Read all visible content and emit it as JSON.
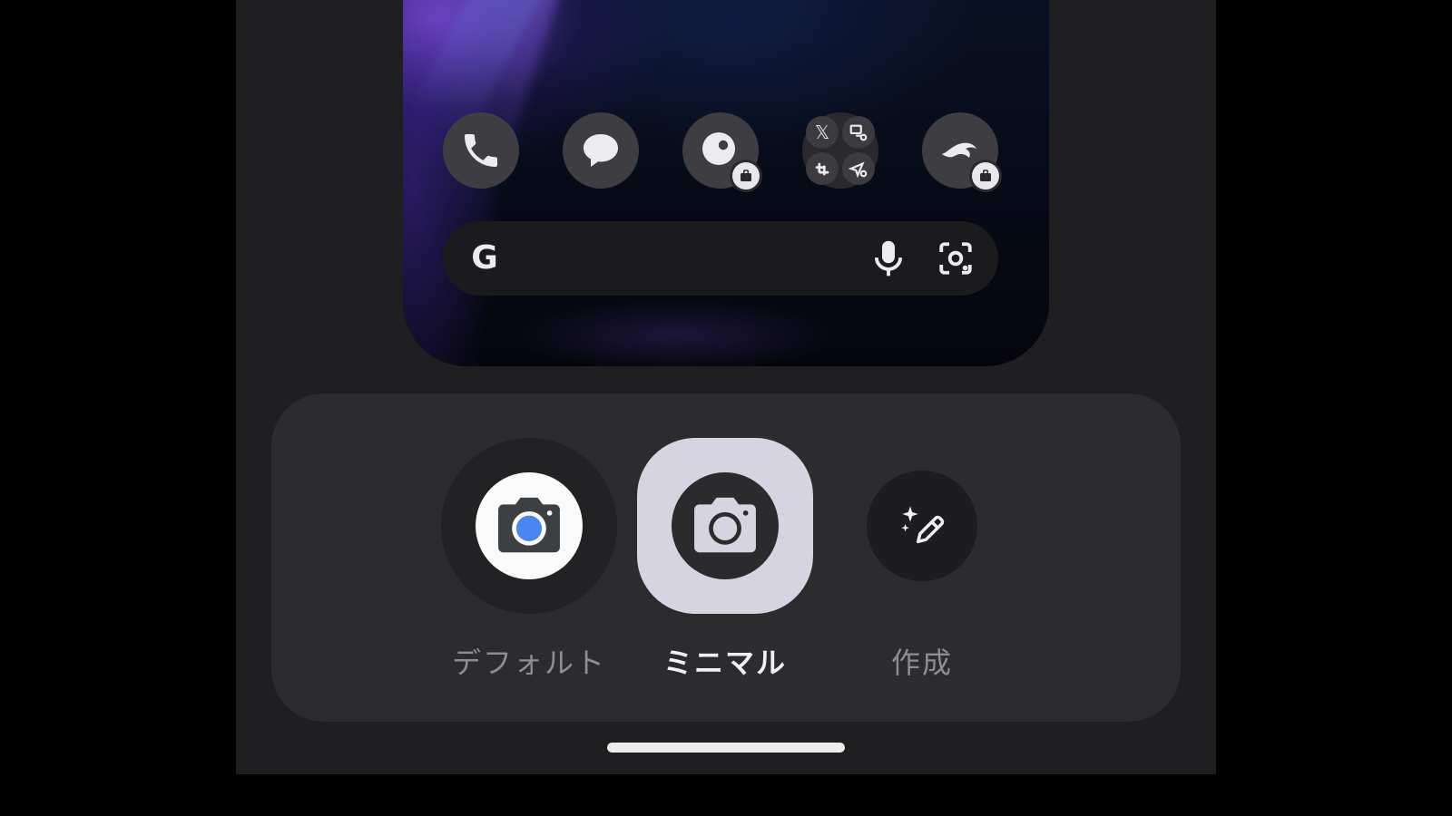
{
  "preview": {
    "dock": [
      {
        "name": "phone-icon",
        "work_badge": false
      },
      {
        "name": "messages-icon",
        "work_badge": false
      },
      {
        "name": "chat-app-icon",
        "work_badge": true
      },
      {
        "name": "app-folder",
        "work_badge": false
      },
      {
        "name": "bird-app-icon",
        "work_badge": true
      }
    ],
    "folder_apps": [
      "x-icon",
      "remote-icon",
      "slack-icon",
      "send-icon"
    ],
    "folder_x_glyph": "𝕏",
    "search": {
      "logo": "G",
      "icons": [
        "microphone-icon",
        "lens-icon"
      ]
    }
  },
  "styles": {
    "options": [
      {
        "label": "デフォルト",
        "icon": "camera-color-icon",
        "selected": false
      },
      {
        "label": "ミニマル",
        "icon": "camera-mono-icon",
        "selected": true
      },
      {
        "label": "作成",
        "icon": "sparkle-pencil-icon",
        "selected": false
      }
    ]
  },
  "colors": {
    "camera_lens": "#4a86f0",
    "selected_bg": "#d6d4e0",
    "panel_bg": "#2c2c2f"
  }
}
